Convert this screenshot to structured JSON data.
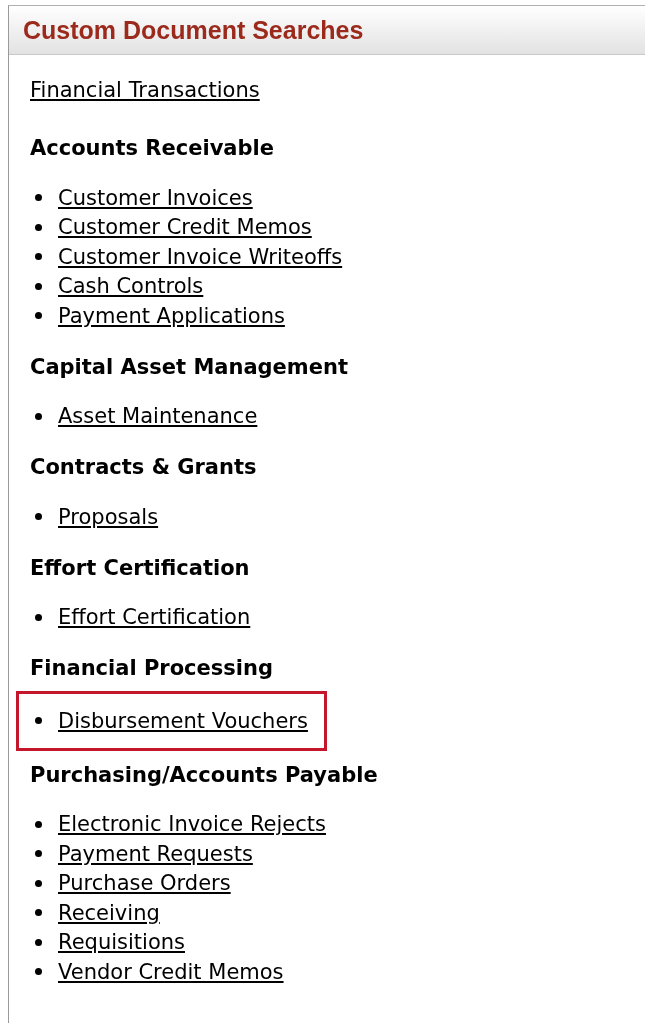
{
  "panel": {
    "title": "Custom Document Searches"
  },
  "top_link": "Financial Transactions",
  "sections": [
    {
      "heading": "Accounts Receivable",
      "items": [
        {
          "label": "Customer Invoices",
          "highlighted": false
        },
        {
          "label": "Customer Credit Memos",
          "highlighted": false
        },
        {
          "label": "Customer Invoice Writeoffs",
          "highlighted": false
        },
        {
          "label": "Cash Controls",
          "highlighted": false
        },
        {
          "label": "Payment Applications",
          "highlighted": false
        }
      ]
    },
    {
      "heading": "Capital Asset Management",
      "items": [
        {
          "label": "Asset Maintenance",
          "highlighted": false
        }
      ]
    },
    {
      "heading": "Contracts & Grants",
      "items": [
        {
          "label": "Proposals",
          "highlighted": false
        }
      ]
    },
    {
      "heading": "Effort Certification",
      "items": [
        {
          "label": "Effort Certification",
          "highlighted": false
        }
      ]
    },
    {
      "heading": "Financial Processing",
      "items": [
        {
          "label": "Disbursement Vouchers",
          "highlighted": true
        }
      ]
    },
    {
      "heading": "Purchasing/Accounts Payable",
      "items": [
        {
          "label": "Electronic Invoice Rejects",
          "highlighted": false
        },
        {
          "label": "Payment Requests",
          "highlighted": false
        },
        {
          "label": "Purchase Orders",
          "highlighted": false
        },
        {
          "label": "Receiving",
          "highlighted": false
        },
        {
          "label": "Requisitions",
          "highlighted": false
        },
        {
          "label": "Vendor Credit Memos",
          "highlighted": false
        }
      ]
    }
  ]
}
